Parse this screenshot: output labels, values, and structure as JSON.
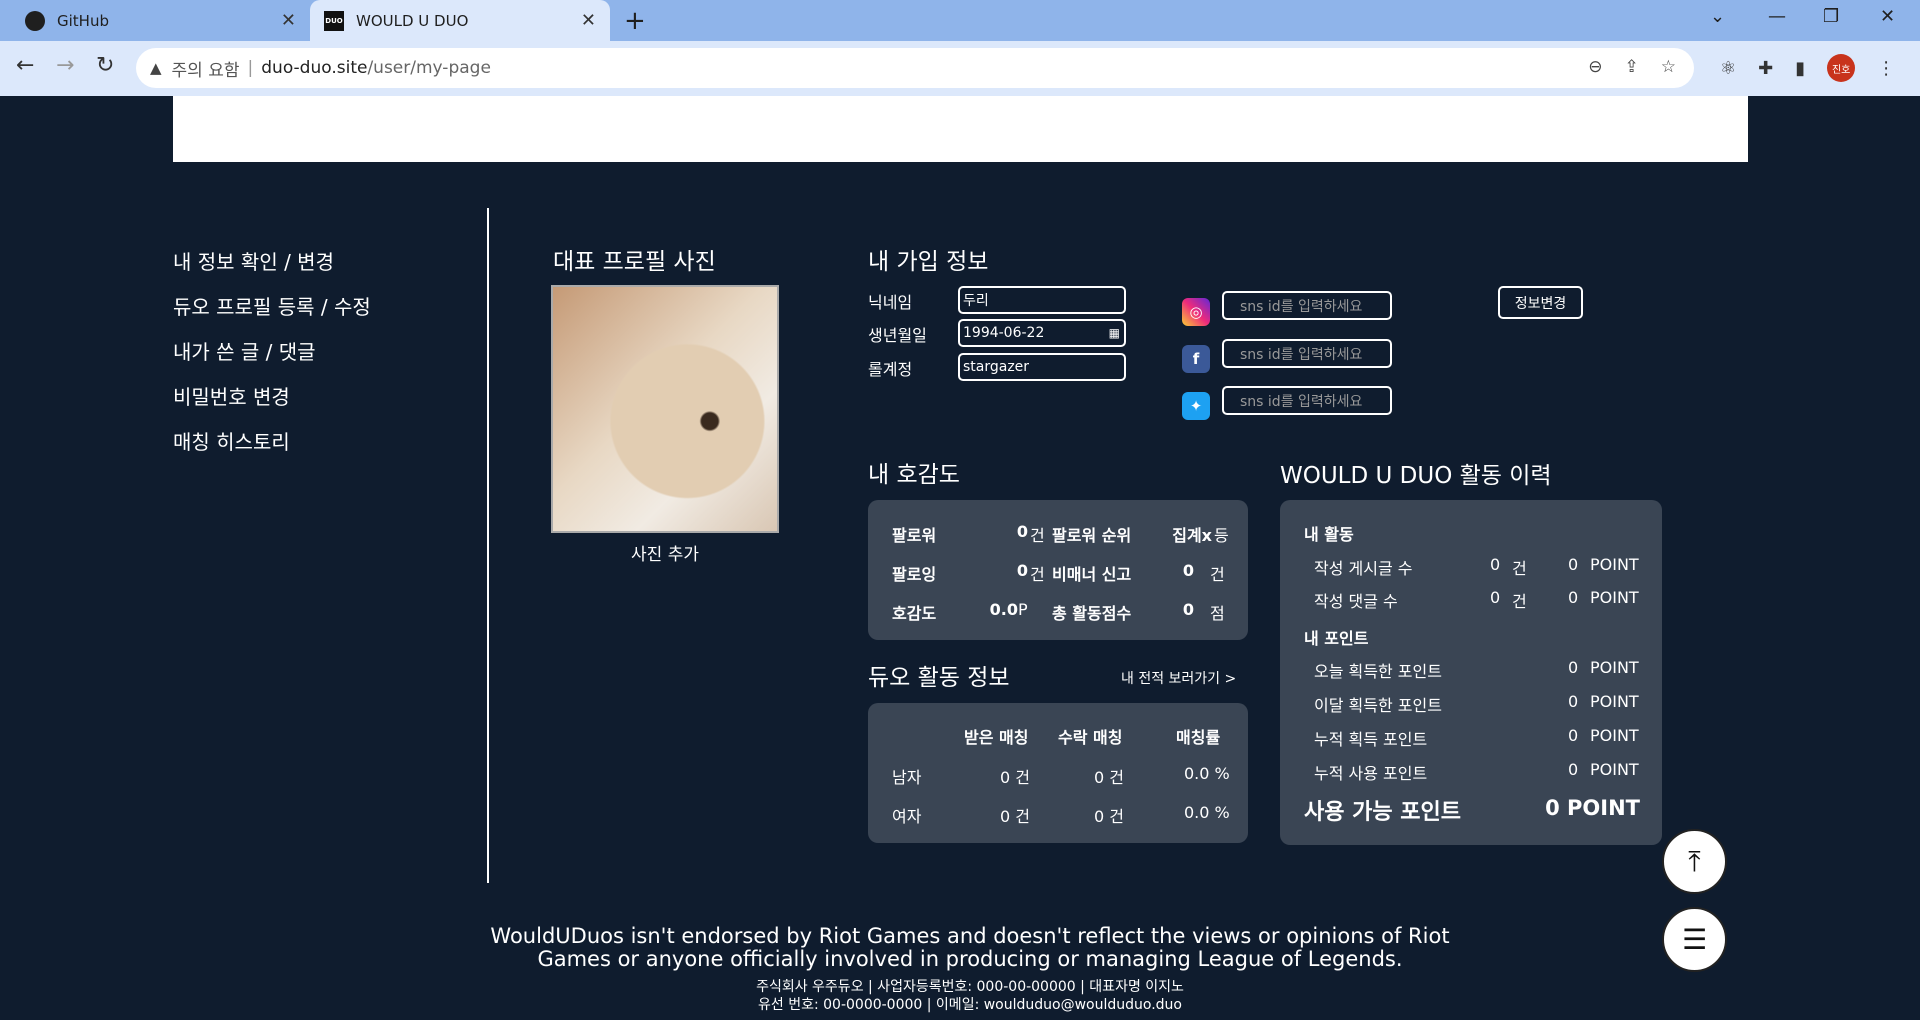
{
  "browser": {
    "tabs": [
      {
        "title": "GitHub",
        "favicon": "github-icon"
      },
      {
        "title": "WOULD U DUO",
        "favicon": "duo-icon"
      }
    ],
    "address": {
      "warning": "주의 요함",
      "host": "duo-duo.site",
      "path": "/user/my-page"
    },
    "profile_initials": "진호"
  },
  "sidenav": {
    "items": [
      {
        "label": "내 정보 확인 / 변경"
      },
      {
        "label": "듀오 프로필 등록 / 수정"
      },
      {
        "label": "내가 쓴 글 / 댓글"
      },
      {
        "label": "비밀번호 변경"
      },
      {
        "label": "매칭 히스토리"
      }
    ]
  },
  "profile_photo": {
    "title": "대표 프로필 사진",
    "add_label": "사진 추가"
  },
  "signup_info": {
    "title": "내 가입 정보",
    "nickname_label": "닉네임",
    "nickname_value": "두리",
    "birth_label": "생년월일",
    "birth_value": "1994-06-22",
    "lol_label": "롤계정",
    "lol_value": "stargazer",
    "sns_placeholder": "sns id를 입력하세요",
    "edit_button": "정보변경"
  },
  "likability": {
    "title": "내 호감도",
    "follower_label": "팔로워",
    "follower_value": "0",
    "follower_unit": "건",
    "follower_rank_label": "팔로워 순위",
    "follower_rank_value": "집계x",
    "follower_rank_unit": "등",
    "following_label": "팔로잉",
    "following_value": "0",
    "following_unit": "건",
    "report_label": "비매너 신고",
    "report_value": "0",
    "report_unit": "건",
    "likability_label": "호감도",
    "likability_value": "0.0",
    "likability_unit": "P",
    "total_label": "총 활동점수",
    "total_value": "0",
    "total_unit": "점"
  },
  "duo_activity": {
    "title": "듀오 활동 정보",
    "record_link": "내 전적 보러가기 >",
    "headers": [
      "받은 매칭",
      "수락 매칭",
      "매칭률"
    ],
    "rows": [
      {
        "label": "남자",
        "received": "0 건",
        "accepted": "0 건",
        "rate": "0.0 %"
      },
      {
        "label": "여자",
        "received": "0 건",
        "accepted": "0 건",
        "rate": "0.0 %"
      }
    ]
  },
  "activity_history": {
    "title": "WOULD U DUO 활동 이력",
    "my_activity_label": "내 활동",
    "posts_label": "작성 게시글 수",
    "posts_count": "0",
    "posts_count_unit": "건",
    "posts_point": "0",
    "comments_label": "작성 댓글 수",
    "comments_count": "0",
    "comments_count_unit": "건",
    "comments_point": "0",
    "point_unit": "POINT",
    "my_points_label": "내 포인트",
    "today_label": "오늘 획득한 포인트",
    "today_point": "0",
    "month_label": "이달 획득한 포인트",
    "month_point": "0",
    "total_earned_label": "누적 획득 포인트",
    "total_earned_point": "0",
    "total_used_label": "누적 사용 포인트",
    "total_used_point": "0",
    "available_label": "사용 가능 포인트",
    "available_point": "0 POINT"
  },
  "footer": {
    "disclaimer": "WouldUDuos isn't endorsed by Riot Games and doesn't reflect the views or opinions of Riot Games or anyone officially involved in producing or managing League of Legends.",
    "company_line": "주식회사 우주듀오 | 사업자등록번호: 000-00-00000 | 대표자명 이지노",
    "contact_line": "유선 번호: 00-0000-0000 | 이메일: woulduduo@woulduduo.duo"
  },
  "icons": {
    "instagram_color": "#d62976",
    "facebook_color": "#3b5998",
    "twitter_color": "#1da1f2",
    "panel_color": "#3a4554",
    "background_color": "#0f1c2e"
  }
}
